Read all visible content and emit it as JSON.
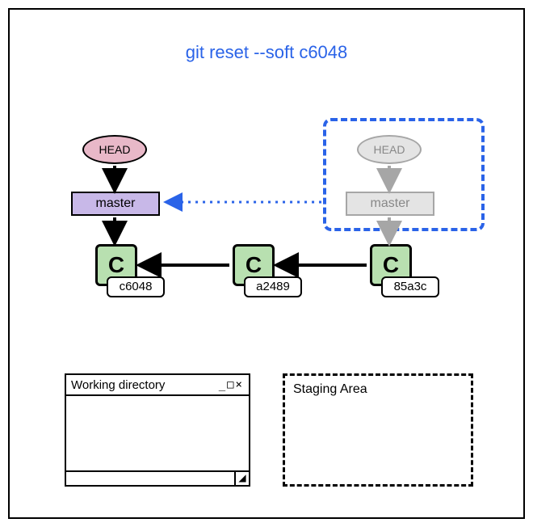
{
  "title": "git reset --soft c6048",
  "head_label": "HEAD",
  "branch_label": "master",
  "commits": [
    {
      "glyph": "C",
      "hash": "c6048"
    },
    {
      "glyph": "C",
      "hash": "a2489"
    },
    {
      "glyph": "C",
      "hash": "85a3c"
    }
  ],
  "ghost": {
    "head_label": "HEAD",
    "branch_label": "master"
  },
  "working_dir_label": "Working directory",
  "window_controls": "_□×",
  "staging_label": "Staging Area"
}
